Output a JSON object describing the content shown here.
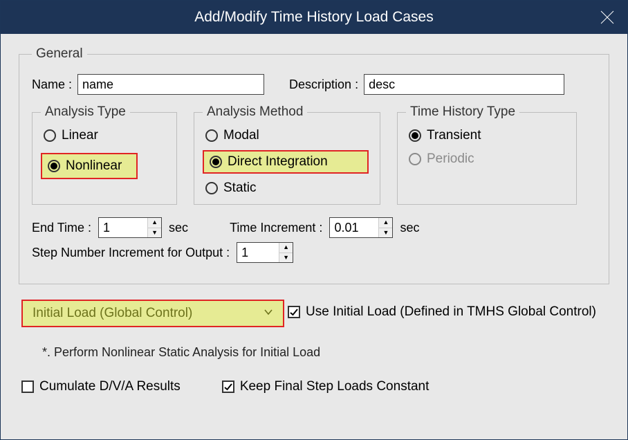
{
  "window": {
    "title": "Add/Modify Time History Load Cases"
  },
  "general": {
    "legend": "General",
    "name_label": "Name :",
    "name_value": "name",
    "desc_label": "Description :",
    "desc_value": "desc"
  },
  "analysis_type": {
    "legend": "Analysis Type",
    "linear": "Linear",
    "nonlinear": "Nonlinear",
    "selected": "nonlinear"
  },
  "analysis_method": {
    "legend": "Analysis Method",
    "modal": "Modal",
    "direct": "Direct Integration",
    "static": "Static",
    "selected": "direct"
  },
  "time_history_type": {
    "legend": "Time History Type",
    "transient": "Transient",
    "periodic": "Periodic",
    "selected": "transient"
  },
  "timing": {
    "end_time_label": "End Time :",
    "end_time_value": "1",
    "end_time_unit": "sec",
    "time_inc_label": "Time Increment :",
    "time_inc_value": "0.01",
    "time_inc_unit": "sec",
    "step_inc_label": "Step Number Increment for Output :",
    "step_inc_value": "1"
  },
  "initial_load": {
    "dropdown_label": "Initial Load (Global Control)",
    "use_label": "Use Initial Load (Defined in TMHS Global Control)",
    "use_checked": true,
    "note": "*. Perform Nonlinear Static Analysis for Initial Load",
    "cumulate_label": "Cumulate D/V/A Results",
    "cumulate_checked": false,
    "keep_label": "Keep Final Step Loads Constant",
    "keep_checked": true
  }
}
